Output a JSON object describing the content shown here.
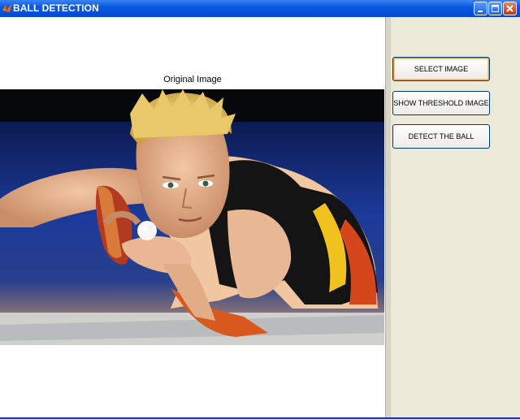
{
  "window": {
    "title": "BALL DETECTION",
    "titlebar_color": "#0a5ae0"
  },
  "axes": {
    "title": "Original Image"
  },
  "image": {
    "subject": "table tennis player holding a white ball"
  },
  "buttons": {
    "select_image": "SELECT IMAGE",
    "show_threshold": "SHOW THRESHOLD IMAGE",
    "detect_ball": "DETECT THE BALL"
  },
  "icons": {
    "app": "matlab-icon",
    "minimize": "minimize-icon",
    "maximize": "maximize-icon",
    "close": "close-icon"
  }
}
